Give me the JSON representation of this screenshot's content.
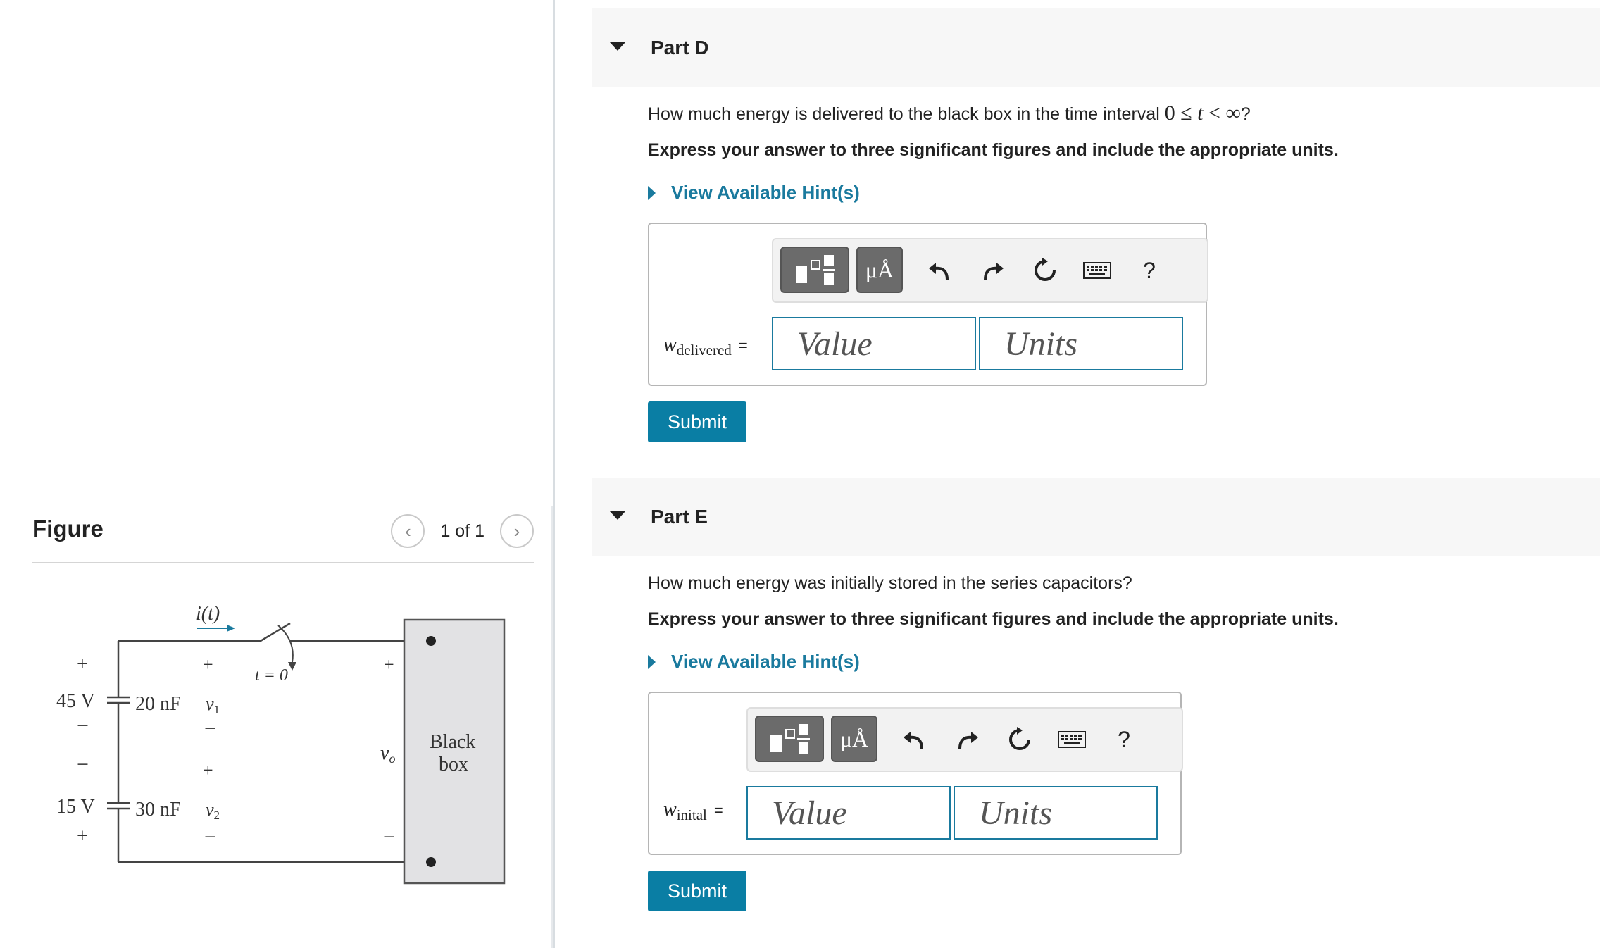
{
  "figure": {
    "title": "Figure",
    "pager": {
      "text": "1 of 1"
    },
    "circuit": {
      "current_label": "i(t)",
      "switch_label": "t = 0",
      "source1": "45 V",
      "source2": "15 V",
      "cap1": "20 nF",
      "cap2": "30 nF",
      "v1": "v",
      "v1_sub": "1",
      "v2": "v",
      "v2_sub": "2",
      "vo": "v",
      "vo_sub": "o",
      "box_line1": "Black",
      "box_line2": "box",
      "plus": "+",
      "minus": "−"
    }
  },
  "parts": [
    {
      "title": "Part D",
      "question_text": "How much energy is delivered to the black box in the time interval ",
      "question_math": {
        "zero": "0",
        "le": " ≤ ",
        "t": "t",
        "lt": " < ",
        "inf": "∞"
      },
      "question_end": "?",
      "instruction": "Express your answer to three significant figures and include the appropriate units.",
      "hint": "View Available Hint(s)",
      "var_main": "w",
      "var_sub": "delivered",
      "eq": "=",
      "value_placeholder": "Value",
      "units_placeholder": "Units",
      "submit": "Submit"
    },
    {
      "title": "Part E",
      "question_text": "How much energy was initially stored in the series capacitors?",
      "instruction": "Express your answer to three significant figures and include the appropriate units.",
      "hint": "View Available Hint(s)",
      "var_main": "w",
      "var_sub": "inital",
      "eq": "=",
      "value_placeholder": "Value",
      "units_placeholder": "Units",
      "submit": "Submit"
    }
  ],
  "toolbar": {
    "units_button": "μÅ",
    "help": "?"
  }
}
